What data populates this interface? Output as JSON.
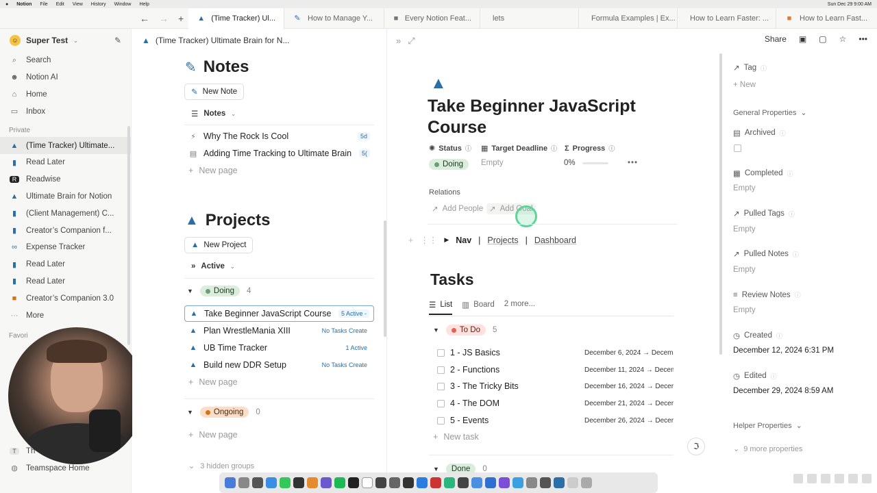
{
  "menubar": {
    "app": "Notion",
    "items": [
      "File",
      "Edit",
      "View",
      "History",
      "Window",
      "Help"
    ],
    "clock": "Sun Dec 29  9:00 AM"
  },
  "tabs": [
    {
      "label": "(Time Tracker) Ul...",
      "icon": "rocket-icon",
      "active": true
    },
    {
      "label": "How to Manage Y...",
      "icon": "pencil-icon"
    },
    {
      "label": "Every Notion Feat...",
      "icon": "video-icon"
    },
    {
      "label": "lets",
      "icon": ""
    },
    {
      "label": "Formula Examples | Ex...",
      "icon": ""
    },
    {
      "label": "How to Learn Faster: ...",
      "icon": ""
    },
    {
      "label": "How to Learn Fast...",
      "icon": "tf-icon"
    }
  ],
  "sidebar": {
    "workspace": "Super Test",
    "top": [
      {
        "label": "Search",
        "icon": "search-icon"
      },
      {
        "label": "Notion AI",
        "icon": "ai-icon"
      },
      {
        "label": "Home",
        "icon": "home-icon"
      },
      {
        "label": "Inbox",
        "icon": "inbox-icon"
      }
    ],
    "private_label": "Private",
    "items": [
      {
        "label": "(Time Tracker) Ultimate...",
        "icon": "rocket-icon",
        "selected": true
      },
      {
        "label": "Read Later",
        "icon": "book-icon"
      },
      {
        "label": "Readwise",
        "icon": "readwise-icon"
      },
      {
        "label": "Ultimate Brain for Notion",
        "icon": "rocket-icon"
      },
      {
        "label": "(Client Management) C...",
        "icon": "book-icon"
      },
      {
        "label": "Creator’s Companion f...",
        "icon": "book-icon"
      },
      {
        "label": "Expense Tracker",
        "icon": "link-icon"
      },
      {
        "label": "Read Later",
        "icon": "book-icon"
      },
      {
        "label": "Read Later",
        "icon": "book-icon"
      },
      {
        "label": "Creator’s Companion 3.0",
        "icon": "box-icon"
      },
      {
        "label": "More",
        "icon": "more-icon"
      }
    ],
    "favorites_label": "Favori",
    "bottom_t": "Th",
    "teamspace": "Teamspace Home"
  },
  "left": {
    "breadcrumb": "(Time Tracker) Ultimate Brain for N...",
    "notes_title": "Notes",
    "new_note": "New Note",
    "notes_view": "Notes",
    "notes": [
      {
        "label": "Why The Rock Is Cool",
        "meta": "5d"
      },
      {
        "label": "Adding Time Tracking to Ultimate Brain",
        "meta": "5("
      }
    ],
    "new_page": "New page",
    "projects_title": "Projects",
    "new_project": "New Project",
    "projects_view": "Active",
    "doing_label": "Doing",
    "doing_count": "4",
    "projects": [
      {
        "label": "Take Beginner JavaScript Course",
        "meta": "5 Active -"
      },
      {
        "label": "Plan WrestleMania XIII",
        "meta": "No Tasks Create"
      },
      {
        "label": "UB Time Tracker",
        "meta": "1 Active"
      },
      {
        "label": "Build new DDR Setup",
        "meta": "No Tasks Create"
      }
    ],
    "ongoing_label": "Ongoing",
    "ongoing_count": "0",
    "hidden_groups": "3 hidden groups"
  },
  "main": {
    "title": "Take Beginner JavaScript Course",
    "props": {
      "status_h": "Status",
      "deadline_h": "Target Deadline",
      "progress_h": "Progress",
      "status_v": "Doing",
      "deadline_v": "Empty",
      "progress_v": "0%"
    },
    "progress_fraction": 0,
    "relations": "Relations",
    "add_people": "Add People",
    "add_goal": "Add Goal",
    "nav": {
      "label": "Nav",
      "sep": "|",
      "links": [
        "Projects",
        "Dashboard"
      ]
    },
    "tasks_title": "Tasks",
    "views": [
      "List",
      "Board",
      "2 more..."
    ],
    "todo_label": "To Do",
    "todo_count": "5",
    "tasks": [
      {
        "label": "1 - JS Basics",
        "date": "December 6, 2024 → Decem"
      },
      {
        "label": "2 - Functions",
        "date": "December 11, 2024 → Decem"
      },
      {
        "label": "3 - The Tricky Bits",
        "date": "December 16, 2024 → Decer"
      },
      {
        "label": "4 - The DOM",
        "date": "December 21, 2024 → Decer"
      },
      {
        "label": "5 - Events",
        "date": "December 26, 2024 → Decer"
      }
    ],
    "new_task": "New task",
    "done_label": "Done",
    "done_count": "0"
  },
  "right": {
    "share": "Share",
    "tag": "Tag",
    "new": "New",
    "general": "General Properties",
    "archived": "Archived",
    "completed": "Completed",
    "empty": "Empty",
    "pulled_tags": "Pulled Tags",
    "pulled_notes": "Pulled Notes",
    "review_notes": "Review Notes",
    "created": "Created",
    "created_v": "December 12, 2024 6:31 PM",
    "edited": "Edited",
    "edited_v": "December 29, 2024 8:59 AM",
    "helper": "Helper Properties",
    "more_props": "9 more properties"
  }
}
